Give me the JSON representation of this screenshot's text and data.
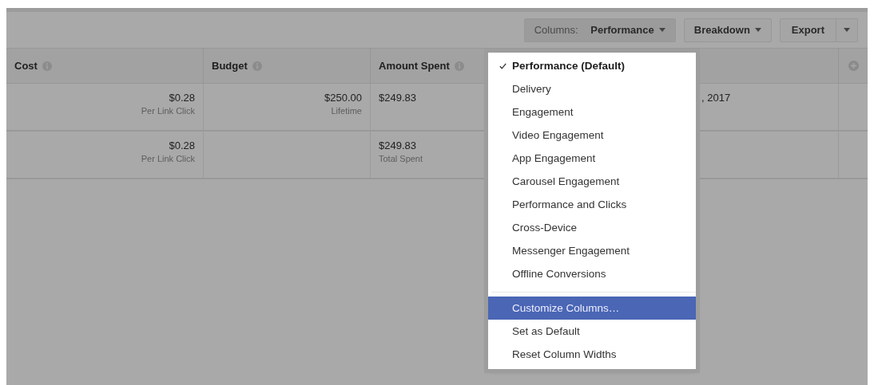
{
  "toolbar": {
    "columns_button": {
      "label": "Columns:",
      "value": "Performance"
    },
    "breakdown_button": {
      "label": "Breakdown"
    },
    "export_button": {
      "label": "Export"
    }
  },
  "table": {
    "columns": [
      {
        "label": "Cost"
      },
      {
        "label": "Budget"
      },
      {
        "label": "Amount Spent"
      },
      {}
    ],
    "rows": [
      {
        "cells": [
          {
            "value": "$0.28",
            "sub": "Per Link Click"
          },
          {
            "value": "$250.00",
            "sub": "Lifetime"
          },
          {
            "value": "$249.83"
          },
          {
            "value": ", 2017"
          }
        ]
      },
      {
        "cells": [
          {
            "value": "$0.28",
            "sub": "Per Link Click"
          },
          {},
          {
            "value": "$249.83",
            "sub": "Total Spent"
          },
          {}
        ]
      }
    ]
  },
  "menu": {
    "items": [
      {
        "kind": "option",
        "label": "Performance (Default)",
        "selected": true,
        "highlighted": false
      },
      {
        "kind": "option",
        "label": "Delivery",
        "selected": false,
        "highlighted": false
      },
      {
        "kind": "option",
        "label": "Engagement",
        "selected": false,
        "highlighted": false
      },
      {
        "kind": "option",
        "label": "Video Engagement",
        "selected": false,
        "highlighted": false
      },
      {
        "kind": "option",
        "label": "App Engagement",
        "selected": false,
        "highlighted": false
      },
      {
        "kind": "option",
        "label": "Carousel Engagement",
        "selected": false,
        "highlighted": false
      },
      {
        "kind": "option",
        "label": "Performance and Clicks",
        "selected": false,
        "highlighted": false
      },
      {
        "kind": "option",
        "label": "Cross-Device",
        "selected": false,
        "highlighted": false
      },
      {
        "kind": "option",
        "label": "Messenger Engagement",
        "selected": false,
        "highlighted": false
      },
      {
        "kind": "option",
        "label": "Offline Conversions",
        "selected": false,
        "highlighted": false
      },
      {
        "kind": "separator"
      },
      {
        "kind": "action",
        "label": "Customize Columns…",
        "highlighted": true
      },
      {
        "kind": "action",
        "label": "Set as Default",
        "highlighted": false
      },
      {
        "kind": "action",
        "label": "Reset Column Widths",
        "highlighted": false
      }
    ]
  }
}
